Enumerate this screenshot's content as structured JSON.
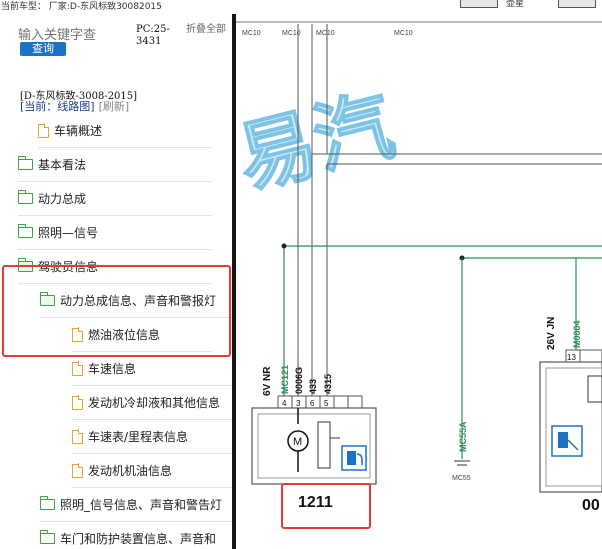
{
  "topbar": {
    "text": "当前车型：  厂家:D-东风标致30082015",
    "right_label": "壶星"
  },
  "search": {
    "placeholder": "输入关键字查",
    "button": "查询",
    "pc_code": "PC:25-3431",
    "collapse_all": "折叠全部"
  },
  "model": "[D-东风标致-3008-2015]",
  "current": {
    "label": "[当前：",
    "value": "线路图]",
    "refresh": "[刷新]"
  },
  "tree": [
    {
      "label": "车辆概述",
      "icon": "doc-icon"
    },
    {
      "label": "基本看法",
      "icon": "folder-icon"
    },
    {
      "label": "动力总成",
      "icon": "folder-icon"
    },
    {
      "label": "照明—信号",
      "icon": "folder-icon"
    },
    {
      "label": "驾驶员信息",
      "icon": "folder-open-icon"
    },
    {
      "label": "动力总成信息、声音和警报灯",
      "icon": "folder-open-icon"
    },
    {
      "label": "燃油液位信息",
      "icon": "doc-icon"
    },
    {
      "label": "车速信息",
      "icon": "doc-icon"
    },
    {
      "label": "发动机冷却液和其他信息",
      "icon": "doc-icon"
    },
    {
      "label": "车速表/里程表信息",
      "icon": "doc-icon"
    },
    {
      "label": "发动机机油信息",
      "icon": "doc-icon"
    },
    {
      "label": "照明_信号信息、声音和警告灯",
      "icon": "folder-icon"
    },
    {
      "label": "车门和防护装置信息、声音和",
      "icon": "folder-icon"
    }
  ],
  "diagram": {
    "label_mc10_a": "MC10",
    "label_mc10_b": "MC10",
    "label_mc10_c": "MC10",
    "label_mc10_d": "MC10",
    "connector_left": "6V NR",
    "wire_1": "MC121",
    "wire_2": "0006G",
    "wire_3": "433",
    "wire_4": "4315",
    "pin_1": "4",
    "pin_2": "3",
    "pin_3": "6",
    "pin_4": "5",
    "component_id": "1211",
    "wire_mc55a": "MC55A",
    "ground_mc55": "MC55",
    "connector_right": "26V JN",
    "wire_m0004": "M0004",
    "pin_13": "13",
    "component_id_right": "00",
    "watermark": "易汽"
  },
  "colors": {
    "accent_blue": "#1b73c6",
    "highlight_red": "#e03c3c",
    "wire_green": "#2e8b57",
    "folder_green": "#3fa33f",
    "doc_orange": "#e6a42a"
  }
}
